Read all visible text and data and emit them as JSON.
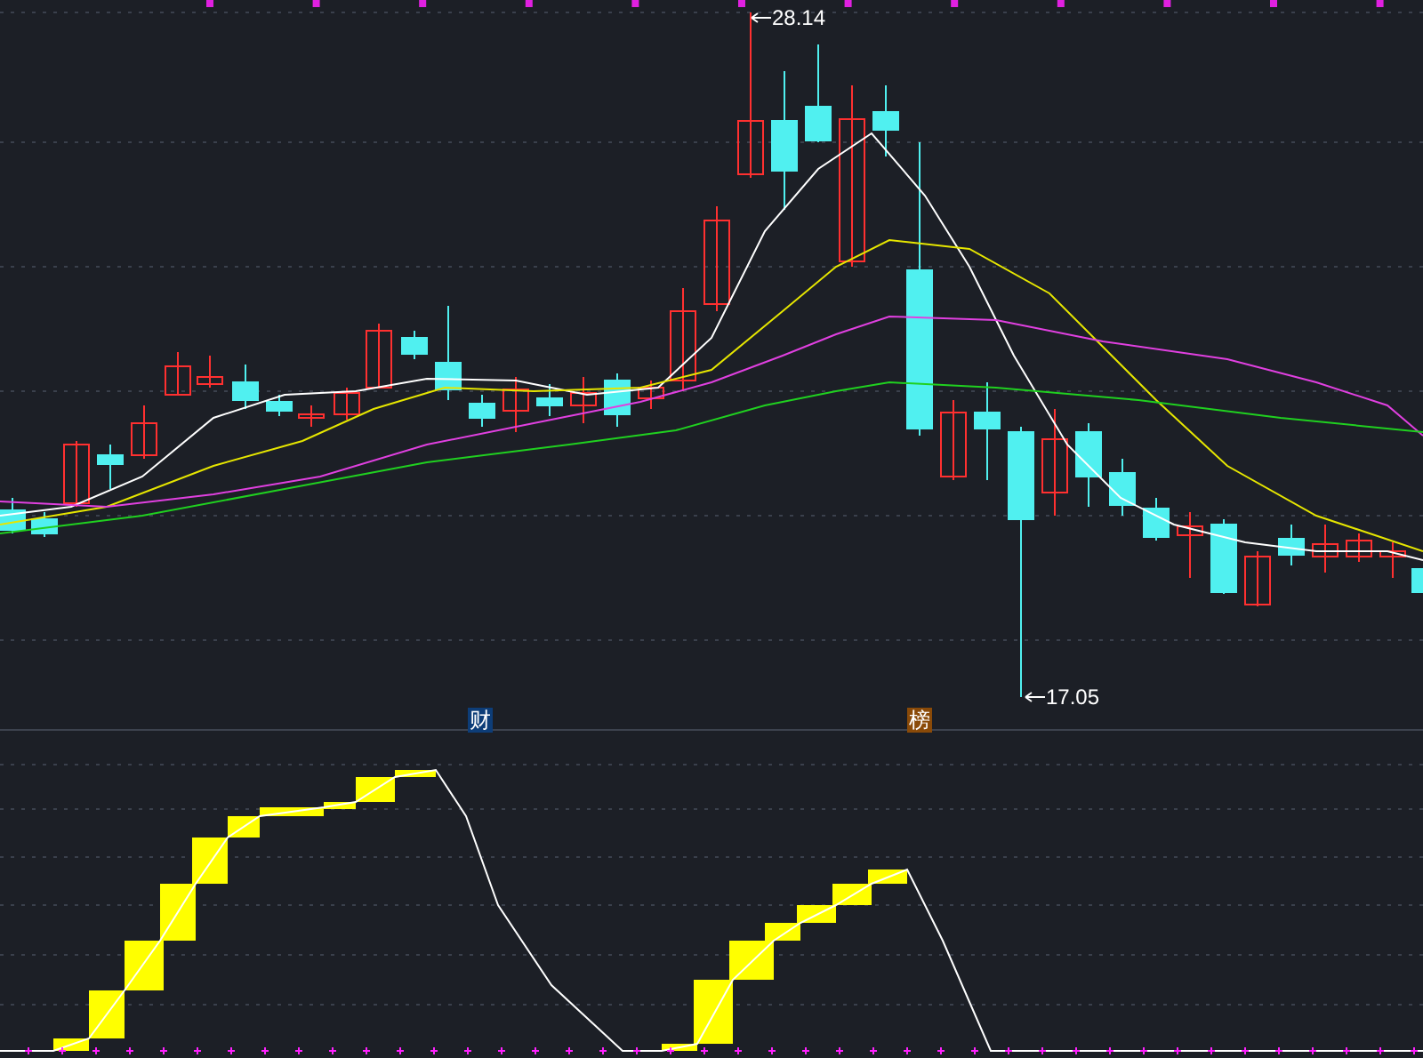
{
  "price_chart": {
    "high_label": "28.14",
    "low_label": "17.05"
  },
  "event_markers": [
    {
      "label": "财",
      "kind": "finance"
    },
    {
      "label": "榜",
      "kind": "ranking"
    }
  ]
}
